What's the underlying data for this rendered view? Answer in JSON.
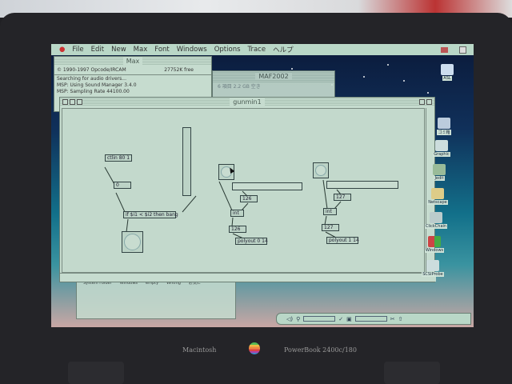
{
  "menubar": {
    "items": [
      "File",
      "Edit",
      "New",
      "Max",
      "Font",
      "Windows",
      "Options",
      "Trace",
      "ヘルプ"
    ]
  },
  "max_window": {
    "title": "Max",
    "copyright": "© 1990-1997 Opcode/IRCAM",
    "memory": "27752K free",
    "log": [
      "Searching for audio drivers...",
      "MSP: Using Sound Manager 3.4.0",
      "MSP: Sampling Rate 44100.00"
    ]
  },
  "maf_window": {
    "title": "MAF2002",
    "info": "6 項目 2.2 GB 空き"
  },
  "patcher": {
    "title": "gunmin1",
    "objects": {
      "ctlin": "ctlin 80 1",
      "num0": "0",
      "ifobj": "if $i1 < $i2 then bang",
      "num1a": "126",
      "int1": "int",
      "num1b": "126",
      "polyout1": "polyout 0 14",
      "num2a": "127",
      "int2": "int",
      "num2b": "127",
      "polyout2": "polyout 1 14"
    }
  },
  "folder_window": {
    "items": [
      "System Folder",
      "Windows",
      "empty",
      "Writing",
      "お気に"
    ]
  },
  "desktop_icons": [
    "ASL",
    "ゴミ箱",
    "Graphic",
    "Jedit",
    "Netscape",
    "ClickChain",
    "Windows",
    "SCSIProbe"
  ],
  "bezel": {
    "left": "Macintosh",
    "right": "PowerBook 2400c/180"
  }
}
